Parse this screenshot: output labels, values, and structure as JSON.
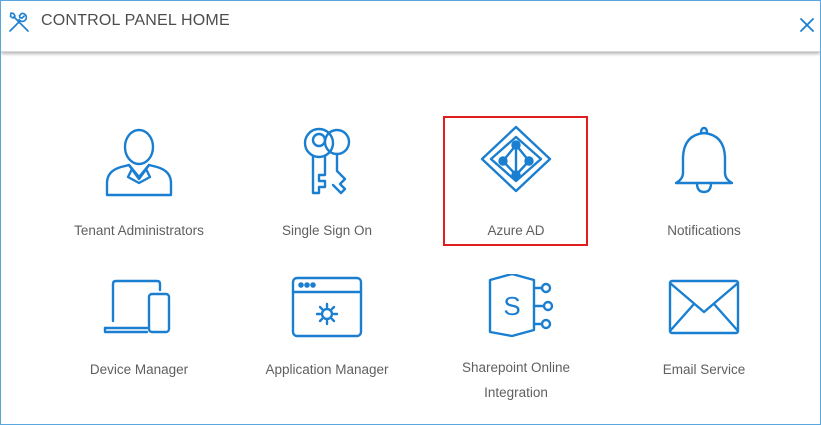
{
  "header": {
    "title": "CONTROL PANEL HOME",
    "icon": "tools-icon",
    "close_icon": "close-icon"
  },
  "colors": {
    "accent": "#1a7fd0",
    "selection": "#e01e1e"
  },
  "tiles": [
    {
      "label": "Tenant Administrators",
      "icon": "user-admin-icon"
    },
    {
      "label": "Single Sign On",
      "icon": "keys-icon"
    },
    {
      "label": "Azure AD",
      "icon": "azure-ad-icon",
      "selected": true
    },
    {
      "label": "Notifications",
      "icon": "bell-icon"
    },
    {
      "label": "Device Manager",
      "icon": "devices-icon"
    },
    {
      "label": "Application Manager",
      "icon": "app-window-gear-icon"
    },
    {
      "label": "Sharepoint Online Integration",
      "icon": "sharepoint-icon"
    },
    {
      "label": "Email Service",
      "icon": "envelope-icon"
    }
  ]
}
